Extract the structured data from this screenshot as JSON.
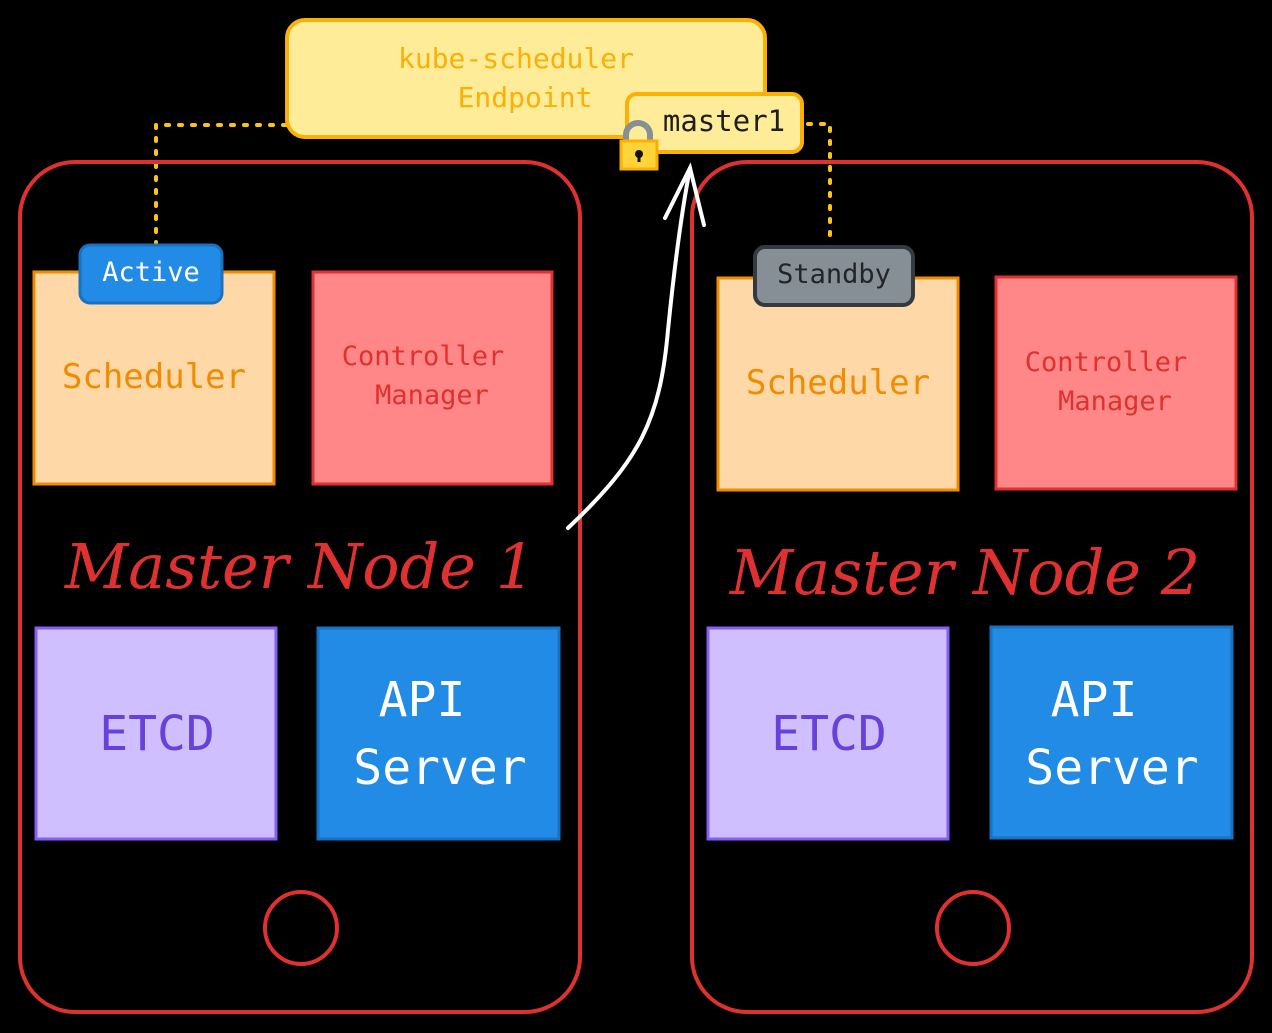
{
  "endpoint": {
    "title_line1": "kube-scheduler",
    "title_line2": "Endpoint",
    "holder": "master1"
  },
  "nodes": [
    {
      "title": "Master Node 1",
      "status": "Active",
      "scheduler": "Scheduler",
      "cm_line1": "Controller",
      "cm_line2": "Manager",
      "etcd": "ETCD",
      "api_line1": "API",
      "api_line2": "Server"
    },
    {
      "title": "Master Node 2",
      "status": "Standby",
      "scheduler": "Scheduler",
      "cm_line1": "Controller",
      "cm_line2": "Manager",
      "etcd": "ETCD",
      "api_line1": "API",
      "api_line2": "Server"
    }
  ],
  "colors": {
    "node_border": "#e03131",
    "scheduler_fill": "#ffd8a8",
    "scheduler_stroke": "#f08c00",
    "cm_fill": "#ff8787",
    "cm_text": "#e03131",
    "etcd_fill": "#d0bfff",
    "etcd_text": "#6741d9",
    "api_fill": "#228be6",
    "active": "#1c7ed6",
    "standby": "#868e96",
    "endpoint_fill": "#ffec99",
    "endpoint_stroke": "#fab005",
    "link": "#fcc419"
  }
}
